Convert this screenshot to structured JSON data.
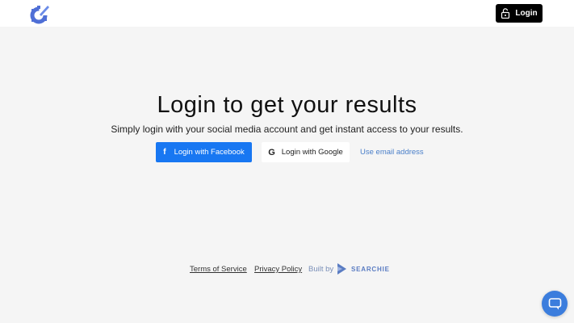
{
  "header": {
    "logo_icon": "brand-logo-icon",
    "login_label": "Login",
    "login_icon": "unlock-icon"
  },
  "main": {
    "headline": "Login to get your results",
    "subline": "Simply login with your social media account and get instant access to your results.",
    "facebook_label": "Login with Facebook",
    "facebook_icon_glyph": "f",
    "google_label": "Login with Google",
    "google_icon_glyph": "G",
    "email_link": "Use email address"
  },
  "footer": {
    "terms": "Terms of Service",
    "privacy": "Privacy Policy",
    "built_by": "Built by",
    "brand_name": "SEARCHIE"
  },
  "colors": {
    "facebook_blue": "#1877f2",
    "link_blue": "#4a7fc9",
    "chat_blue": "#3b7ddd",
    "brand_blue": "#5a7cc2"
  }
}
